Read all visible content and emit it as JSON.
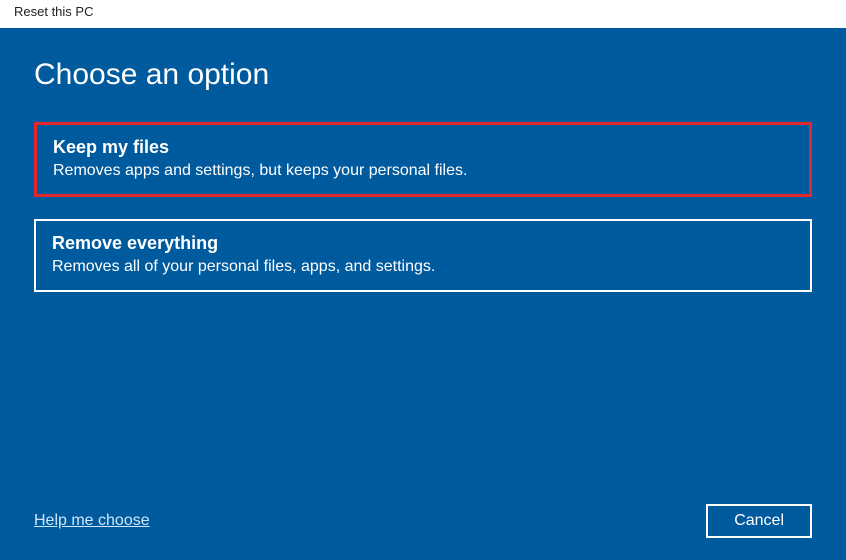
{
  "window": {
    "title": "Reset this PC"
  },
  "header": {
    "title": "Choose an option"
  },
  "options": {
    "keep": {
      "title": "Keep my files",
      "desc": "Removes apps and settings, but keeps your personal files."
    },
    "remove": {
      "title": "Remove everything",
      "desc": "Removes all of your personal files, apps, and settings."
    }
  },
  "footer": {
    "help": "Help me choose",
    "cancel": "Cancel"
  }
}
